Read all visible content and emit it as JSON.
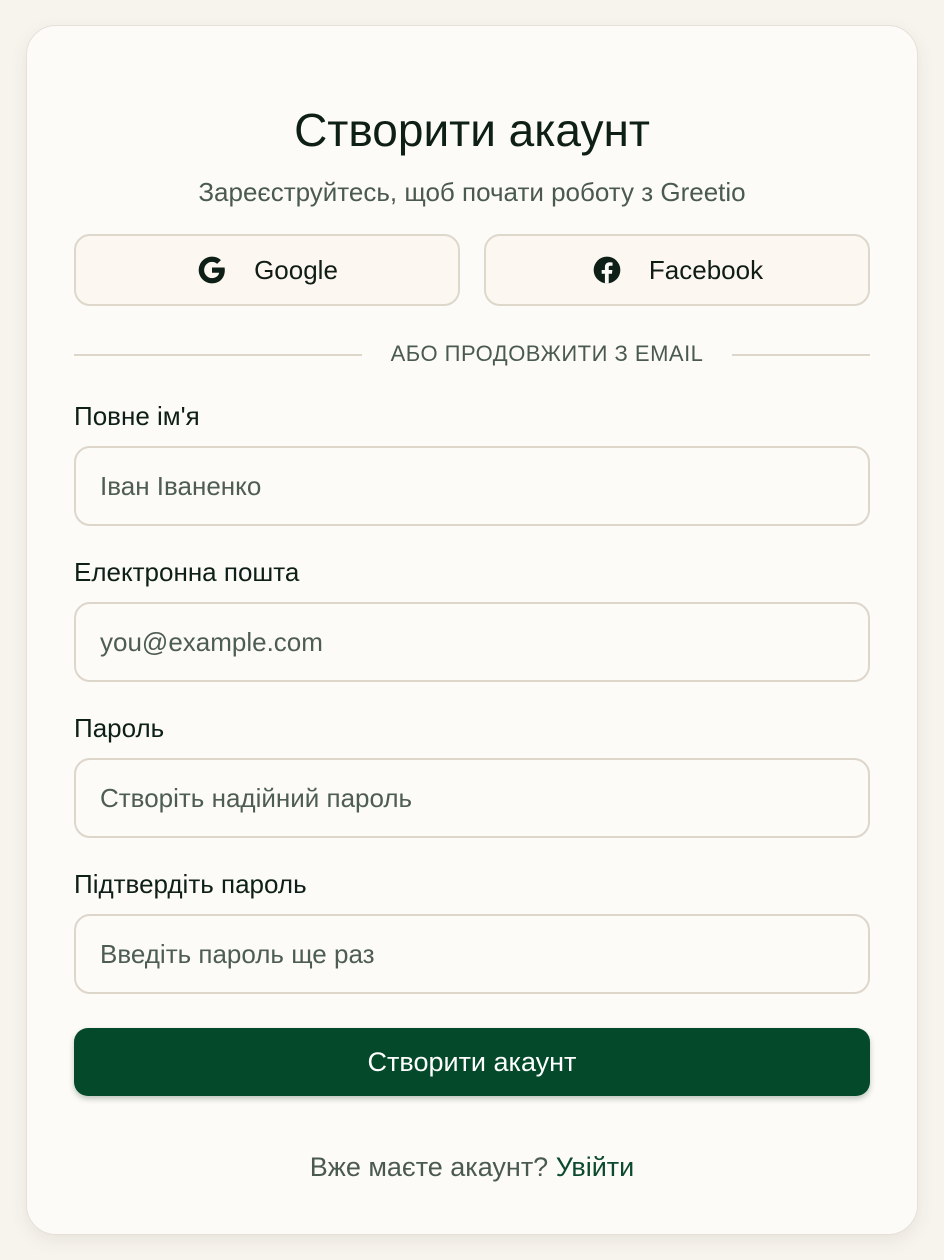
{
  "header": {
    "title": "Створити акаунт",
    "subtitle": "Зареєструйтесь, щоб почати роботу з Greetio"
  },
  "social": {
    "google_label": "Google",
    "facebook_label": "Facebook"
  },
  "divider_text": "АБО ПРОДОВЖИТИ З EMAIL",
  "form": {
    "full_name": {
      "label": "Повне ім'я",
      "placeholder": "Іван Іваненко",
      "value": ""
    },
    "email": {
      "label": "Електронна пошта",
      "placeholder": "you@example.com",
      "value": ""
    },
    "password": {
      "label": "Пароль",
      "placeholder": "Створіть надійний пароль",
      "value": ""
    },
    "confirm_password": {
      "label": "Підтвердіть пароль",
      "placeholder": "Введіть пароль ще раз",
      "value": ""
    },
    "submit_label": "Створити акаунт"
  },
  "footer": {
    "prompt": "Вже маєте акаунт?",
    "login_link": "Увійти"
  },
  "colors": {
    "primary": "#03492a",
    "background": "#fdfbf7",
    "border": "#dcd6cb"
  },
  "icons": {
    "google": "google-icon",
    "facebook": "facebook-icon"
  }
}
